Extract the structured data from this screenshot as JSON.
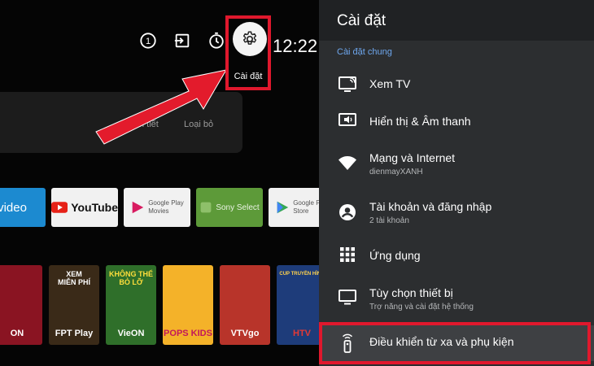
{
  "topbar": {
    "icons": [
      "info-icon",
      "input-icon",
      "timer-icon"
    ],
    "settings_icon": "gear-icon",
    "settings_label": "Cài đặt",
    "time": "12:22"
  },
  "card": {
    "link_details": "n tiết",
    "link_remove": "Loại bỏ"
  },
  "apps": [
    {
      "name": "prime-video",
      "label": "video"
    },
    {
      "name": "youtube",
      "label": "YouTube"
    },
    {
      "name": "google-play-movies",
      "label": "Google Play\nMovies"
    },
    {
      "name": "sony-select",
      "label": "Sony Select"
    },
    {
      "name": "google-play-store",
      "label": "Google Play\nStore"
    }
  ],
  "posters": [
    {
      "top": "",
      "bottom": "ON"
    },
    {
      "top": "XEM\nMIỄN PHÍ",
      "bottom": "FPT Play"
    },
    {
      "top": "KHÔNG THỂ\nBỎ LỠ",
      "bottom": "VieON"
    },
    {
      "top": "",
      "bottom": "POPS KIDS"
    },
    {
      "top": "",
      "bottom": "VTVgo"
    },
    {
      "top": "CUP TRUYỀN HÌNH",
      "bottom": "HTV"
    }
  ],
  "panel": {
    "title": "Cài đặt",
    "section": "Cài đặt chung",
    "items": [
      {
        "icon": "tv-cast-icon",
        "title": "Xem TV",
        "subtitle": ""
      },
      {
        "icon": "display-sound-icon",
        "title": "Hiển thị & Âm thanh",
        "subtitle": ""
      },
      {
        "icon": "wifi-icon",
        "title": "Mạng và Internet",
        "subtitle": "dienmayXANH"
      },
      {
        "icon": "account-icon",
        "title": "Tài khoản và đăng nhập",
        "subtitle": "2 tài khoản"
      },
      {
        "icon": "apps-grid-icon",
        "title": "Ứng dụng",
        "subtitle": ""
      },
      {
        "icon": "monitor-icon",
        "title": "Tùy chọn thiết bị",
        "subtitle": "Trợ năng và cài đặt hệ thống"
      },
      {
        "icon": "remote-icon",
        "title": "Điều khiển từ xa và phụ kiện",
        "subtitle": ""
      }
    ]
  },
  "colors": {
    "highlight": "#e0182d",
    "accent": "#6ea7ee",
    "panel": "#2c2e30"
  }
}
